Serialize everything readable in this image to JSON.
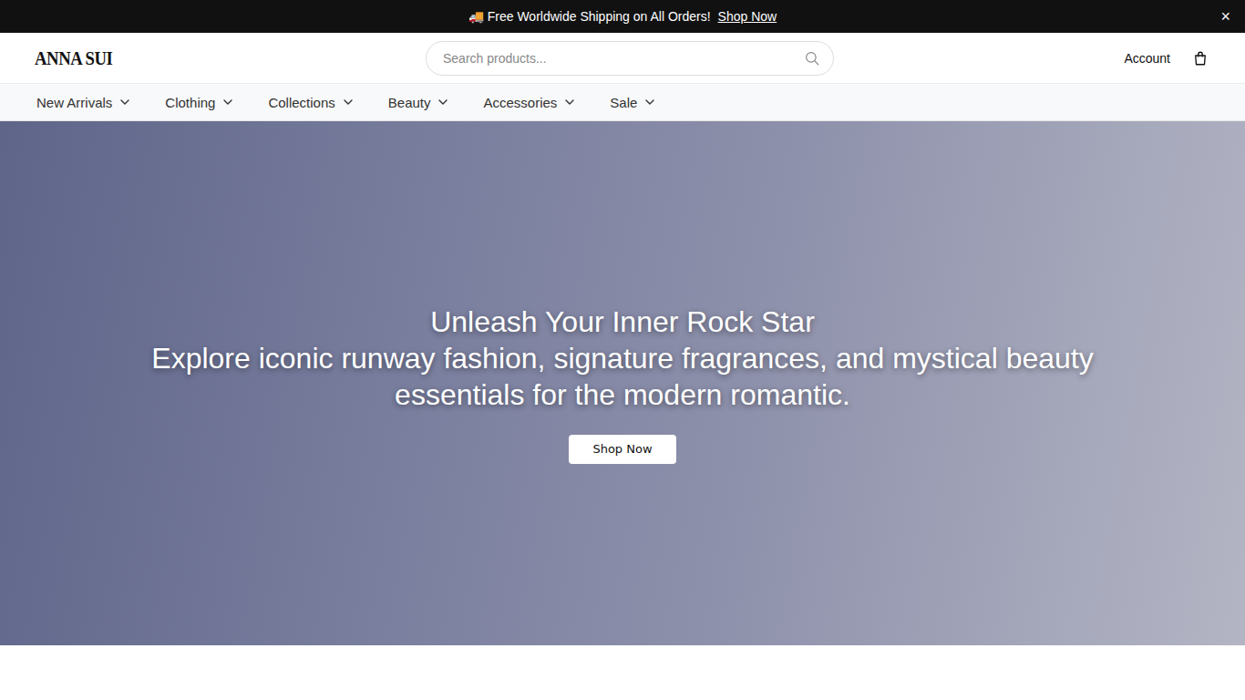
{
  "announcement": {
    "icon": "🚚",
    "text": "Free Worldwide Shipping on All Orders!",
    "link": "Shop Now",
    "close": "×"
  },
  "header": {
    "logo": "ANNA SUI",
    "search": {
      "placeholder": "Search products..."
    },
    "account": "Account"
  },
  "nav": [
    {
      "label": "New Arrivals"
    },
    {
      "label": "Clothing"
    },
    {
      "label": "Collections"
    },
    {
      "label": "Beauty"
    },
    {
      "label": "Accessories"
    },
    {
      "label": "Sale"
    }
  ],
  "hero": {
    "title": "Unleash Your Inner Rock Star",
    "subtitle": "Explore iconic runway fashion, signature fragrances, and mystical beauty essentials for the modern romantic.",
    "button": "Shop Now"
  }
}
